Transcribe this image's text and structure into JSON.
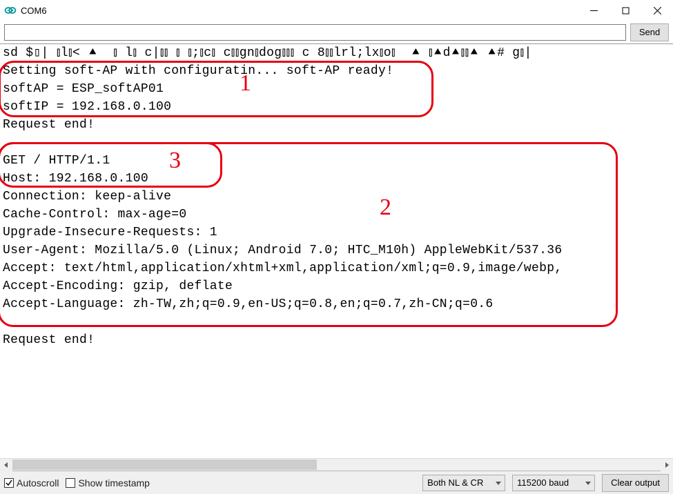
{
  "window": {
    "title": "COM6"
  },
  "toolbar": {
    "input_value": "",
    "input_placeholder": "",
    "send_label": "Send"
  },
  "console": {
    "lines": [
      "sd $▯| ⫾l⫾< ⯅  ⫾ l⫾ c|⫾⫾ ⫾ ⫾;⫾c⫾ c⫾⫾gn⫾dog⫾⫾⫾ c 8⫾⫾lrl;lx⫾o⫾  ⯅ ⫾⯅d⯅⫾⫾⯅ ⯅# g⫾|",
      "Setting soft-AP with configuratin... soft-AP ready!",
      "softAP = ESP_softAP01",
      "softIP = 192.168.0.100",
      "Request end!",
      "",
      "GET / HTTP/1.1",
      "Host: 192.168.0.100",
      "Connection: keep-alive",
      "Cache-Control: max-age=0",
      "Upgrade-Insecure-Requests: 1",
      "User-Agent: Mozilla/5.0 (Linux; Android 7.0; HTC_M10h) AppleWebKit/537.36",
      "Accept: text/html,application/xhtml+xml,application/xml;q=0.9,image/webp,",
      "Accept-Encoding: gzip, deflate",
      "Accept-Language: zh-TW,zh;q=0.9,en-US;q=0.8,en;q=0.7,zh-CN;q=0.6",
      "",
      "Request end!"
    ]
  },
  "annotations": {
    "labels": {
      "one": "1",
      "two": "2",
      "three": "3"
    }
  },
  "scroll": {
    "thumb_percent": 47
  },
  "status": {
    "autoscroll_label": "Autoscroll",
    "autoscroll_checked": true,
    "timestamp_label": "Show timestamp",
    "timestamp_checked": false,
    "line_ending": "Both NL & CR",
    "baud": "115200 baud",
    "clear_label": "Clear output"
  }
}
